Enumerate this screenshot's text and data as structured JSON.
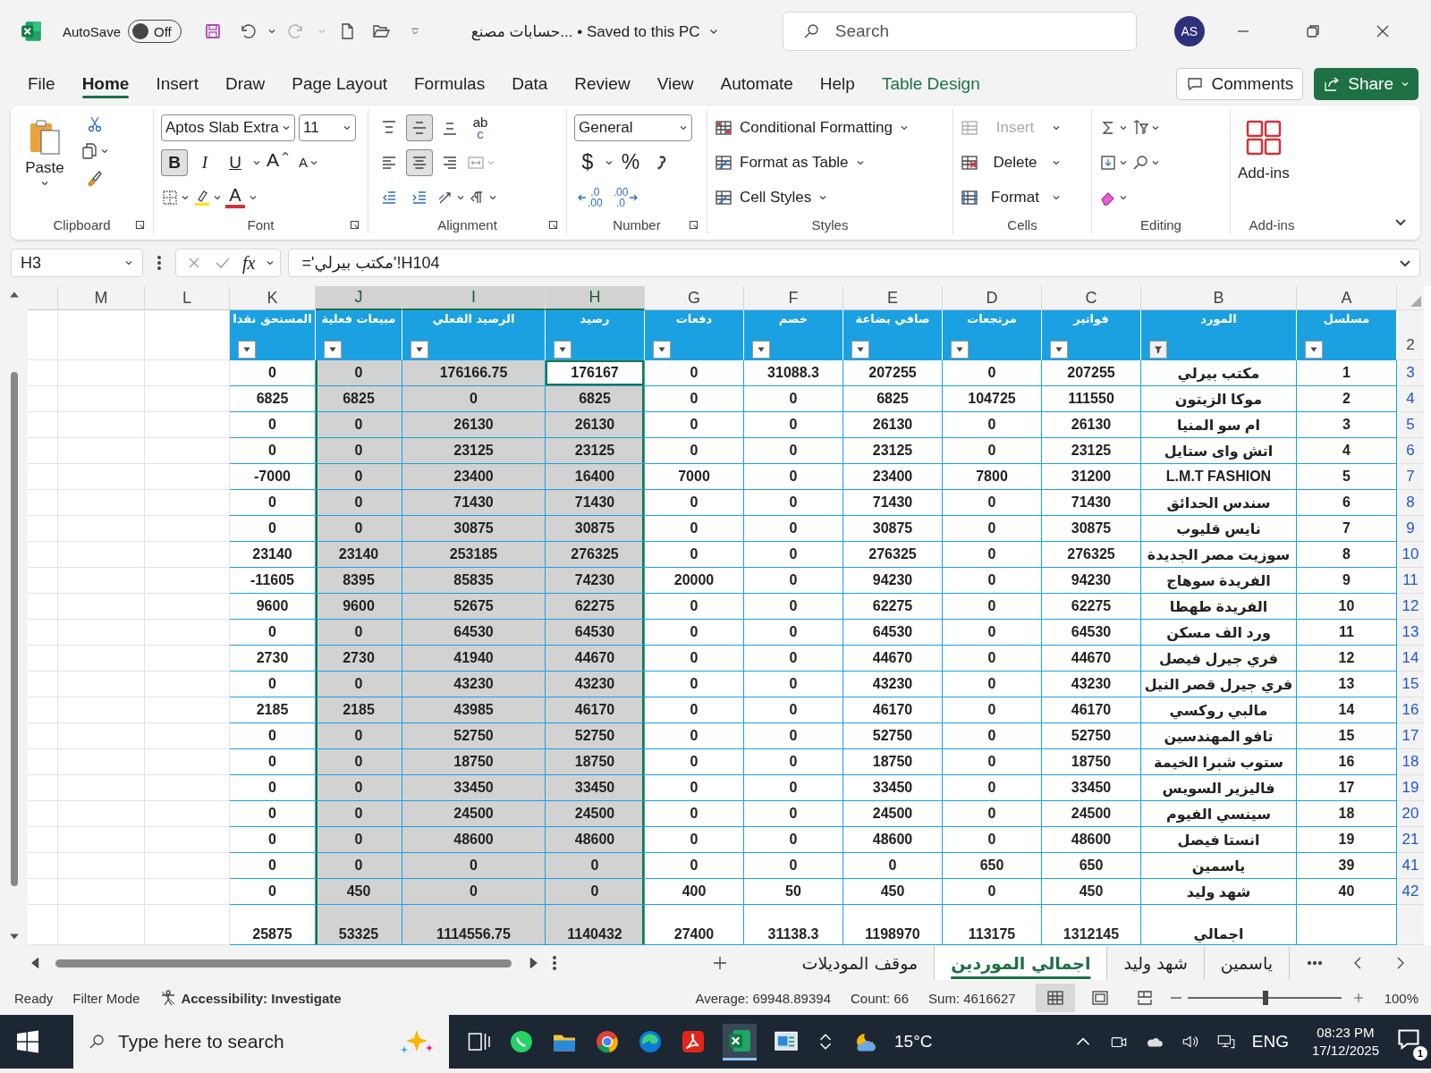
{
  "title_bar": {
    "autosave": {
      "label": "AutoSave",
      "on": false,
      "state": "Off"
    },
    "document": "حسابات مصنع... • Saved to this PC",
    "search": {
      "placeholder": "Search"
    },
    "avatar": "AS"
  },
  "menu_tabs": [
    {
      "label": "File",
      "selected": false,
      "kind": "normal"
    },
    {
      "label": "Home",
      "selected": true,
      "kind": "normal"
    },
    {
      "label": "Insert",
      "selected": false,
      "kind": "normal"
    },
    {
      "label": "Draw",
      "selected": false,
      "kind": "normal"
    },
    {
      "label": "Page Layout",
      "selected": false,
      "kind": "normal"
    },
    {
      "label": "Formulas",
      "selected": false,
      "kind": "normal"
    },
    {
      "label": "Data",
      "selected": false,
      "kind": "normal"
    },
    {
      "label": "Review",
      "selected": false,
      "kind": "normal"
    },
    {
      "label": "View",
      "selected": false,
      "kind": "normal"
    },
    {
      "label": "Automate",
      "selected": false,
      "kind": "normal"
    },
    {
      "label": "Help",
      "selected": false,
      "kind": "normal"
    },
    {
      "label": "Table Design",
      "selected": false,
      "kind": "contextual"
    }
  ],
  "actions": [
    {
      "label": "Comments",
      "kind": "outline"
    },
    {
      "label": "Share",
      "kind": "primary"
    }
  ],
  "ribbon": {
    "clipboard": {
      "title": "Clipboard",
      "paste": "Paste"
    },
    "font": {
      "title": "Font",
      "name": "Aptos Slab Extra",
      "size": "11",
      "styles": [
        {
          "label": "B",
          "selected": true
        },
        {
          "label": "I",
          "selected": false
        },
        {
          "label": "U",
          "selected": false
        }
      ],
      "grow": "A",
      "shrink": "A",
      "color_letter": "A"
    },
    "alignment": {
      "title": "Alignment",
      "vertical": [
        {
          "selected": false
        },
        {
          "selected": true
        },
        {
          "selected": false
        }
      ],
      "horizontal": [
        {
          "selected": false
        },
        {
          "selected": true
        },
        {
          "selected": false
        }
      ],
      "wrap": [
        "ab",
        "c"
      ]
    },
    "number": {
      "title": "Number",
      "format": "General",
      "currency": "$",
      "percent": "%",
      "increase_decimal": [
        ".0",
        ".00"
      ],
      "decrease_decimal": [
        ".00",
        ".0"
      ]
    },
    "styles": {
      "title": "Styles",
      "items": [
        "Conditional Formatting",
        "Format as Table",
        "Cell Styles"
      ]
    },
    "cells": {
      "title": "Cells",
      "items": [
        {
          "label": "Insert",
          "disabled": true
        },
        {
          "label": "Delete",
          "disabled": false
        },
        {
          "label": "Format",
          "disabled": false
        }
      ]
    },
    "editing": {
      "title": "Editing"
    },
    "addins": {
      "title": "Add-ins",
      "button": "Add-ins"
    }
  },
  "formula_bar": {
    "name_box": "H3",
    "fx": "fx",
    "formula": "='مكتب بيرلي'!H104"
  },
  "sheet": {
    "header_row": "2",
    "extra_columns": [
      {
        "letter": "M"
      },
      {
        "letter": "L"
      }
    ],
    "columns": [
      {
        "letter": "K",
        "header": "المستحق نقدا",
        "selected": false,
        "active": false,
        "filtered": false
      },
      {
        "letter": "J",
        "header": "مبيعات فعلية",
        "selected": true,
        "active": false,
        "filtered": false
      },
      {
        "letter": "I",
        "header": "الرصيد الفعلي",
        "selected": true,
        "active": false,
        "filtered": false
      },
      {
        "letter": "H",
        "header": "رصيد",
        "selected": true,
        "active": true,
        "filtered": false
      },
      {
        "letter": "G",
        "header": "دفعات",
        "selected": false,
        "active": false,
        "filtered": false
      },
      {
        "letter": "F",
        "header": "خصم",
        "selected": false,
        "active": false,
        "filtered": false
      },
      {
        "letter": "E",
        "header": "صافي بضاعة",
        "selected": false,
        "active": false,
        "filtered": false
      },
      {
        "letter": "D",
        "header": "مرتجعات",
        "selected": false,
        "active": false,
        "filtered": false
      },
      {
        "letter": "C",
        "header": "فواتير",
        "selected": false,
        "active": false,
        "filtered": false
      },
      {
        "letter": "B",
        "header": "المورد",
        "selected": false,
        "active": false,
        "filtered": true
      },
      {
        "letter": "A",
        "header": "مسلسل",
        "selected": false,
        "active": false,
        "filtered": false
      }
    ],
    "rows": [
      {
        "num": "3",
        "active": true,
        "cells": [
          "0",
          "0",
          "176166.75",
          "176167",
          "0",
          "31088.3",
          "207255",
          "0",
          "207255",
          "مكتب بيرلي",
          "1"
        ]
      },
      {
        "num": "4",
        "active": false,
        "cells": [
          "6825",
          "6825",
          "0",
          "6825",
          "0",
          "0",
          "6825",
          "104725",
          "111550",
          "موكا الزيتون",
          "2"
        ]
      },
      {
        "num": "5",
        "active": false,
        "cells": [
          "0",
          "0",
          "26130",
          "26130",
          "0",
          "0",
          "26130",
          "0",
          "26130",
          "ام سو المنيا",
          "3"
        ]
      },
      {
        "num": "6",
        "active": false,
        "cells": [
          "0",
          "0",
          "23125",
          "23125",
          "0",
          "0",
          "23125",
          "0",
          "23125",
          "اتش واى ستايل",
          "4"
        ]
      },
      {
        "num": "7",
        "active": false,
        "cells": [
          "-7000",
          "0",
          "23400",
          "16400",
          "7000",
          "0",
          "23400",
          "7800",
          "31200",
          "L.M.T FASHION",
          "5"
        ]
      },
      {
        "num": "8",
        "active": false,
        "cells": [
          "0",
          "0",
          "71430",
          "71430",
          "0",
          "0",
          "71430",
          "0",
          "71430",
          "سندس الحدائق",
          "6"
        ]
      },
      {
        "num": "9",
        "active": false,
        "cells": [
          "0",
          "0",
          "30875",
          "30875",
          "0",
          "0",
          "30875",
          "0",
          "30875",
          "نايس قليوب",
          "7"
        ]
      },
      {
        "num": "10",
        "active": false,
        "cells": [
          "23140",
          "23140",
          "253185",
          "276325",
          "0",
          "0",
          "276325",
          "0",
          "276325",
          "سوزيت مصر الجديدة",
          "8"
        ]
      },
      {
        "num": "11",
        "active": false,
        "cells": [
          "-11605",
          "8395",
          "85835",
          "74230",
          "20000",
          "0",
          "94230",
          "0",
          "94230",
          "الفريدة سوهاج",
          "9"
        ]
      },
      {
        "num": "12",
        "active": false,
        "cells": [
          "9600",
          "9600",
          "52675",
          "62275",
          "0",
          "0",
          "62275",
          "0",
          "62275",
          "الفريدة طهطا",
          "10"
        ]
      },
      {
        "num": "13",
        "active": false,
        "cells": [
          "0",
          "0",
          "64530",
          "64530",
          "0",
          "0",
          "64530",
          "0",
          "64530",
          "ورد الف مسكن",
          "11"
        ]
      },
      {
        "num": "14",
        "active": false,
        "cells": [
          "2730",
          "2730",
          "41940",
          "44670",
          "0",
          "0",
          "44670",
          "0",
          "44670",
          "فري جيرل فيصل",
          "12"
        ]
      },
      {
        "num": "15",
        "active": false,
        "cells": [
          "0",
          "0",
          "43230",
          "43230",
          "0",
          "0",
          "43230",
          "0",
          "43230",
          "فري جيرل قصر النيل",
          "13"
        ]
      },
      {
        "num": "16",
        "active": false,
        "cells": [
          "2185",
          "2185",
          "43985",
          "46170",
          "0",
          "0",
          "46170",
          "0",
          "46170",
          "مالبي روكسي",
          "14"
        ]
      },
      {
        "num": "17",
        "active": false,
        "cells": [
          "0",
          "0",
          "52750",
          "52750",
          "0",
          "0",
          "52750",
          "0",
          "52750",
          "تافو المهندسين",
          "15"
        ]
      },
      {
        "num": "18",
        "active": false,
        "cells": [
          "0",
          "0",
          "18750",
          "18750",
          "0",
          "0",
          "18750",
          "0",
          "18750",
          "ستوب شبرا الخيمة",
          "16"
        ]
      },
      {
        "num": "19",
        "active": false,
        "cells": [
          "0",
          "0",
          "33450",
          "33450",
          "0",
          "0",
          "33450",
          "0",
          "33450",
          "فاليزير السويس",
          "17"
        ]
      },
      {
        "num": "20",
        "active": false,
        "cells": [
          "0",
          "0",
          "24500",
          "24500",
          "0",
          "0",
          "24500",
          "0",
          "24500",
          "سينسي الفيوم",
          "18"
        ]
      },
      {
        "num": "21",
        "active": false,
        "cells": [
          "0",
          "0",
          "48600",
          "48600",
          "0",
          "0",
          "48600",
          "0",
          "48600",
          "انستا فيصل",
          "19"
        ]
      },
      {
        "num": "41",
        "active": false,
        "cells": [
          "0",
          "0",
          "0",
          "0",
          "0",
          "0",
          "0",
          "650",
          "650",
          "ياسمين",
          "39"
        ]
      },
      {
        "num": "42",
        "active": false,
        "cells": [
          "0",
          "450",
          "0",
          "0",
          "400",
          "50",
          "450",
          "0",
          "450",
          "شهد وليد",
          "40"
        ]
      }
    ],
    "total": {
      "cells": [
        "25875",
        "53325",
        "1114556.75",
        "1140432",
        "27400",
        "31138.3",
        "1198970",
        "113175",
        "1312145",
        "اجمالي"
      ]
    }
  },
  "sheet_tabs": [
    {
      "label": "ياسمين",
      "selected": false
    },
    {
      "label": "شهد وليد",
      "selected": false
    },
    {
      "label": "اجمالي الموردين",
      "selected": true
    },
    {
      "label": "موقف الموديلات",
      "selected": false
    }
  ],
  "status_bar": {
    "ready": "Ready",
    "filter": "Filter Mode",
    "accessibility": "Accessibility: Investigate",
    "average": "Average: 69948.89394",
    "count": "Count: 66",
    "sum": "Sum: 4616627",
    "views": [
      {
        "kind": "normal",
        "selected": true
      },
      {
        "kind": "page-layout",
        "selected": false
      },
      {
        "kind": "page-break",
        "selected": false
      }
    ],
    "zoom": {
      "level": 0.51,
      "label": "100%"
    }
  },
  "taskbar": {
    "search": {
      "placeholder": "Type here to search"
    },
    "temperature": "15°C",
    "language": "ENG",
    "time": "08:23 PM",
    "date": "17/12/2025",
    "notifications": "1"
  }
}
